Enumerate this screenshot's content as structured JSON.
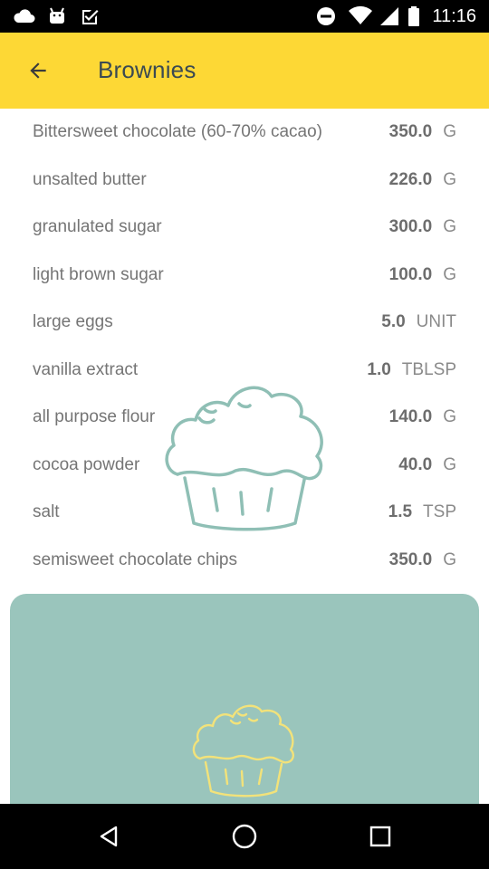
{
  "status_bar": {
    "time": "11:16",
    "left_icons": [
      "cloud-icon",
      "android-icon",
      "checkbox-icon"
    ],
    "right_icons": [
      "do-not-disturb-icon",
      "wifi-icon",
      "signal-icon",
      "battery-icon"
    ]
  },
  "app_bar": {
    "title": "Brownies",
    "back_icon": "arrow-back-icon",
    "color": "#fdd835"
  },
  "ingredients": [
    {
      "name": "Bittersweet chocolate (60-70% cacao)",
      "amount": "350.0",
      "unit": "G"
    },
    {
      "name": "unsalted butter",
      "amount": "226.0",
      "unit": "G"
    },
    {
      "name": "granulated sugar",
      "amount": "300.0",
      "unit": "G"
    },
    {
      "name": "light brown sugar",
      "amount": "100.0",
      "unit": "G"
    },
    {
      "name": "large eggs",
      "amount": "5.0",
      "unit": "UNIT"
    },
    {
      "name": "vanilla extract",
      "amount": "1.0",
      "unit": "TBLSP"
    },
    {
      "name": "all purpose flour",
      "amount": "140.0",
      "unit": "G"
    },
    {
      "name": "cocoa powder",
      "amount": "40.0",
      "unit": "G"
    },
    {
      "name": "salt",
      "amount": "1.5",
      "unit": "TSP"
    },
    {
      "name": "semisweet chocolate chips",
      "amount": "350.0",
      "unit": "G"
    }
  ],
  "decorations": {
    "watermark_icon": "muffin-icon",
    "watermark_color": "#8fbfb5",
    "card_icon": "muffin-icon",
    "card_color": "#9ac5bc",
    "card_icon_color": "#f2e27a"
  },
  "nav_bar": {
    "buttons": [
      "back-triangle-icon",
      "home-circle-icon",
      "recents-square-icon"
    ]
  }
}
